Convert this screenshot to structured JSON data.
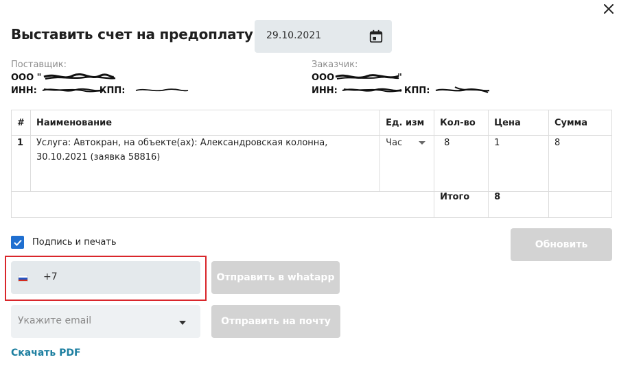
{
  "header": {
    "title": "Выставить счет на предоплату от",
    "date": "29.10.2021"
  },
  "supplier": {
    "caption": "Поставщик:",
    "name": "ООО \"",
    "inn_label": "ИНН:",
    "kpp_label": "КПП:"
  },
  "customer": {
    "caption": "Заказчик:",
    "name_prefix": "ООО",
    "name_suffix": "\"",
    "inn_label": "ИНН:",
    "kpp_label": "КПП:"
  },
  "table": {
    "headers": [
      "#",
      "Наименование",
      "Ед. изм",
      "Кол-во",
      "Цена",
      "Сумма"
    ],
    "rows": [
      {
        "num": "1",
        "name": "Услуга: Автокран, на объекте(ах): Александровская колонна, 30.10.2021 (заявка 58816)",
        "unit": "Час",
        "qty": "8",
        "price": "1",
        "sum": "8"
      }
    ],
    "total_label": "Итого",
    "total_value": "8"
  },
  "options": {
    "sign_label": "Подпись и печать",
    "sign_checked": true
  },
  "buttons": {
    "refresh": "Обновить",
    "whatsapp": "Отправить в whatapp",
    "mail": "Отправить на почту"
  },
  "phone": {
    "value": "+7",
    "flag": "russia-flag-icon"
  },
  "email": {
    "placeholder": "Укажите email"
  },
  "download": {
    "label": "Скачать PDF"
  },
  "colors": {
    "accent": "#1f6fd0",
    "link": "#1d7fa0",
    "highlight": "#d9262b",
    "disabled_button": "#d3d3d3",
    "field_bg": "#e4e9ec"
  }
}
